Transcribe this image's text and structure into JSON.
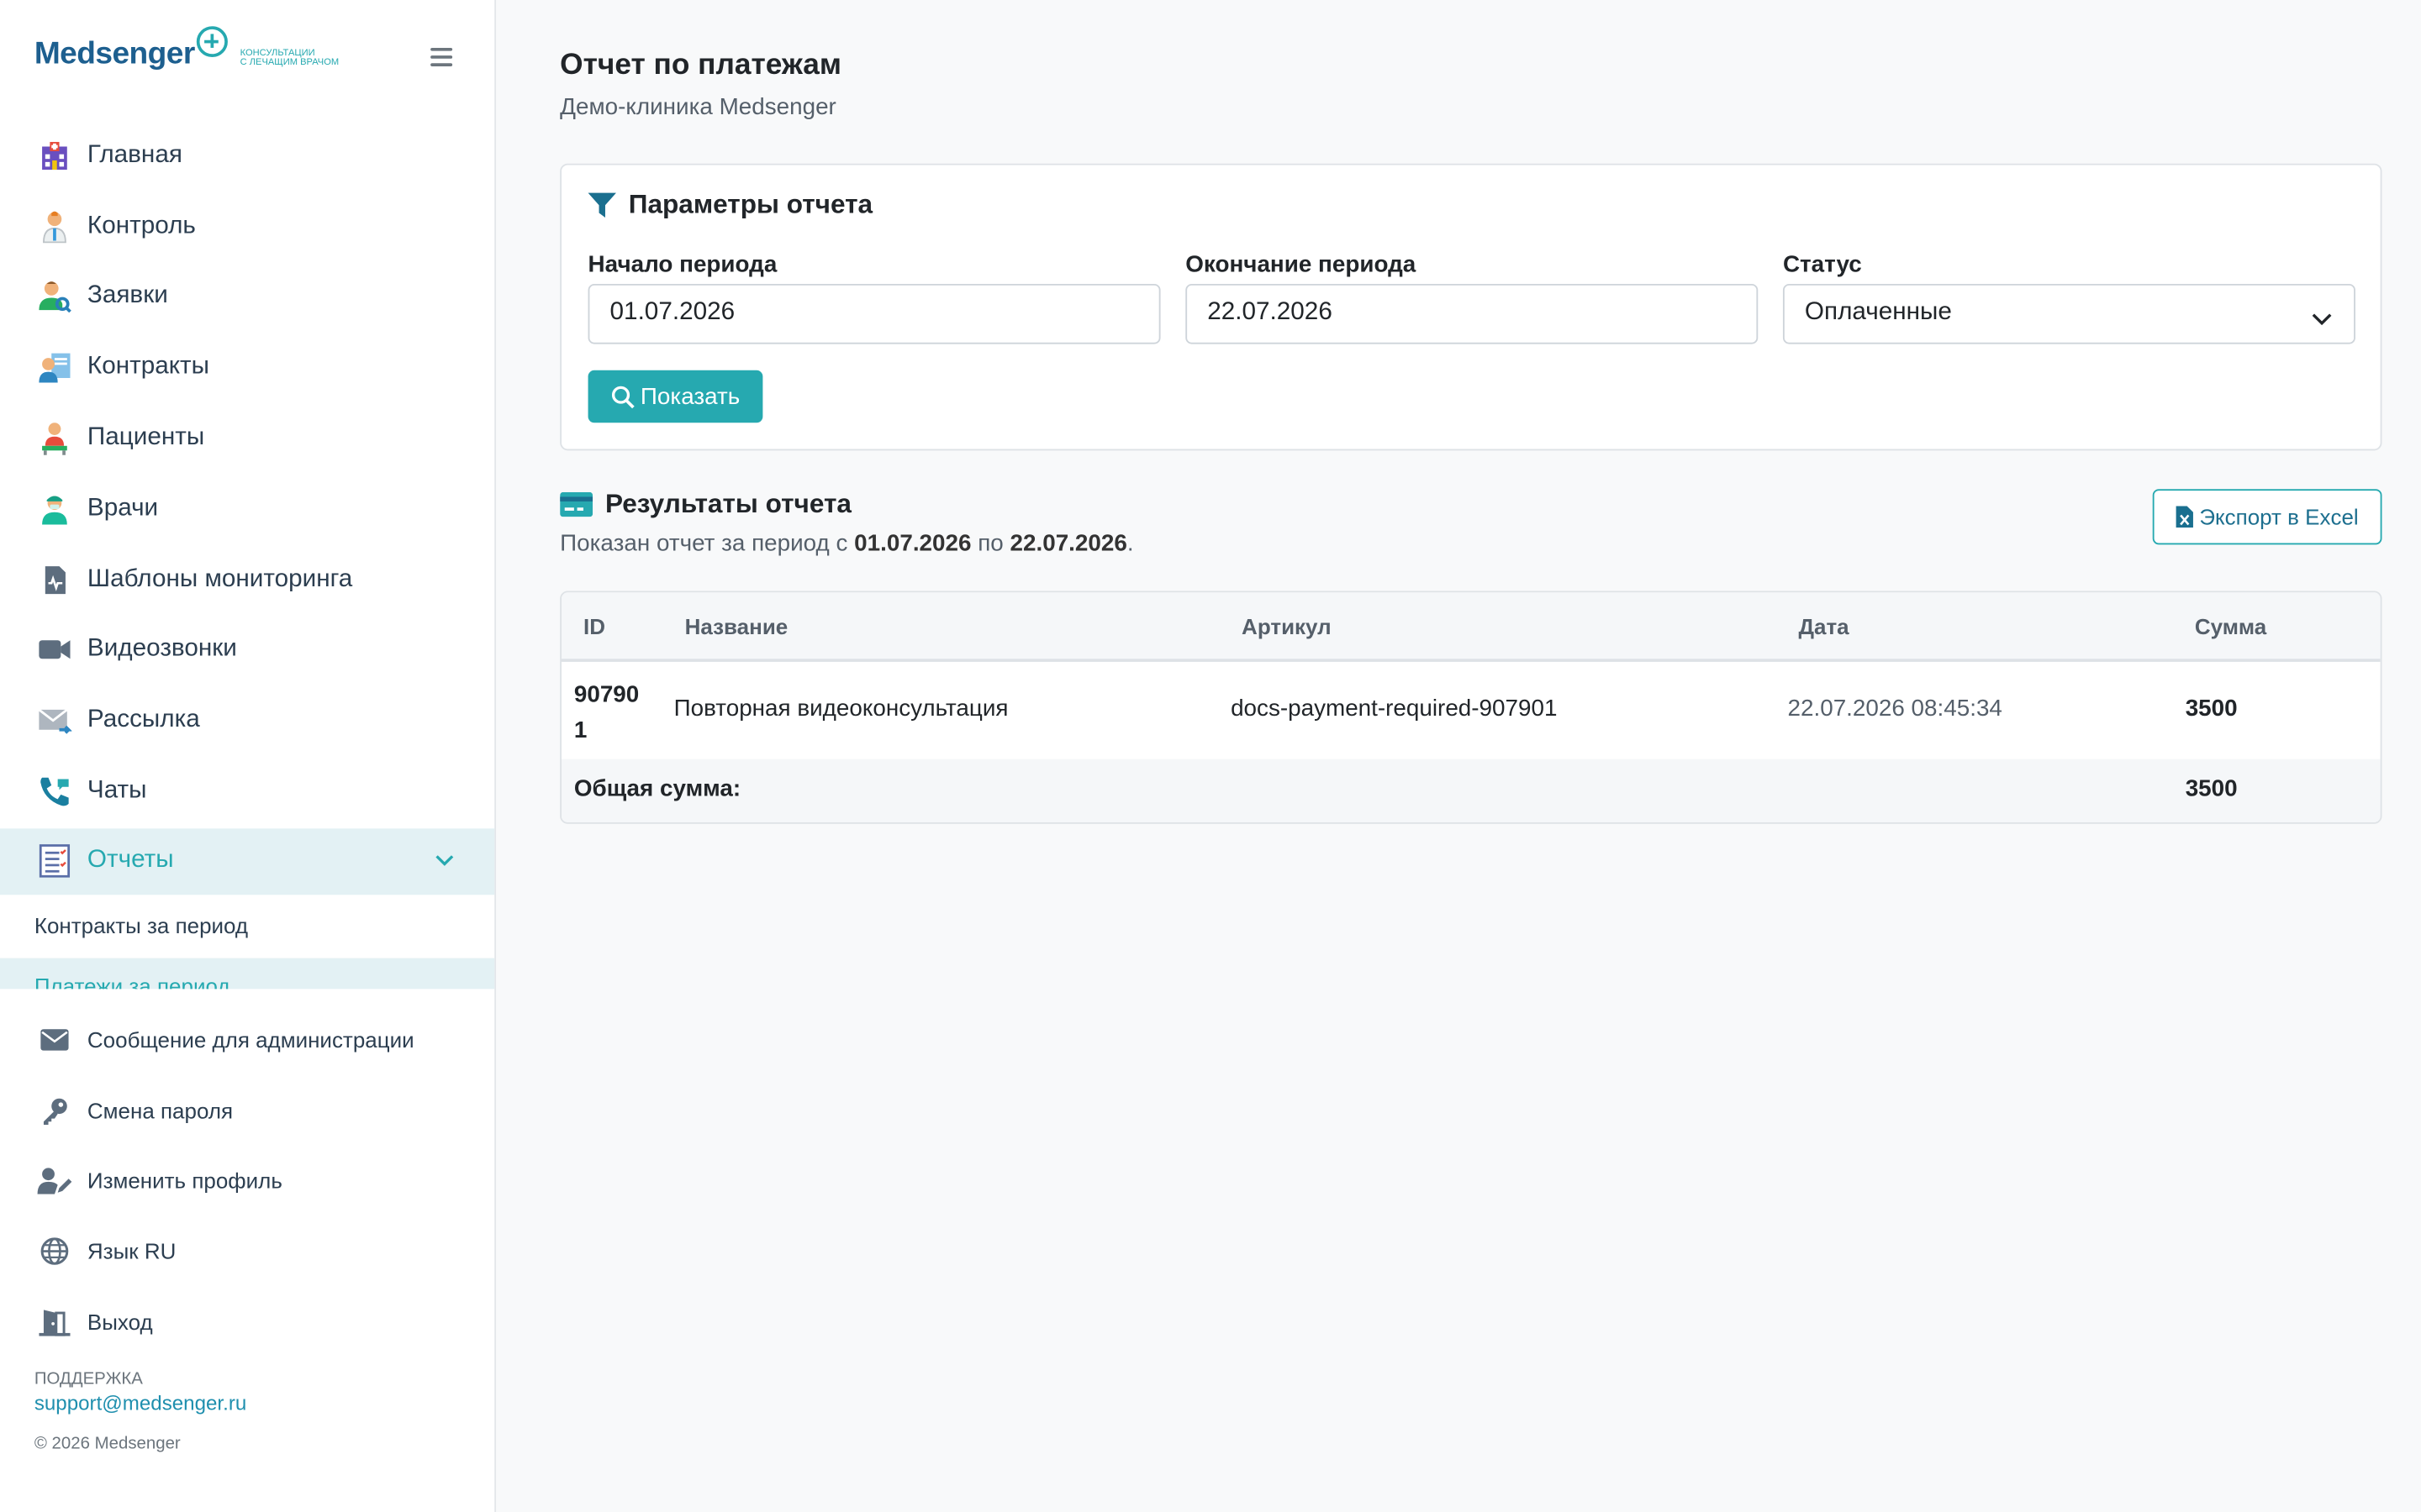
{
  "brand": {
    "name_part1": "Med",
    "name_part2": "senger",
    "tagline_line1": "КОНСУЛЬТАЦИИ",
    "tagline_line2": "С ЛЕЧАЩИМ ВРАЧОМ"
  },
  "sidebar": {
    "items": [
      {
        "label": "Главная",
        "icon": "hospital-icon"
      },
      {
        "label": "Контроль",
        "icon": "doctor-icon"
      },
      {
        "label": "Заявки",
        "icon": "user-search-icon"
      },
      {
        "label": "Контракты",
        "icon": "contract-icon"
      },
      {
        "label": "Пациенты",
        "icon": "patient-icon"
      },
      {
        "label": "Врачи",
        "icon": "medic-icon"
      },
      {
        "label": "Шаблоны мониторинга",
        "icon": "monitoring-template-icon"
      },
      {
        "label": "Видеозвонки",
        "icon": "video-camera-icon"
      },
      {
        "label": "Рассылка",
        "icon": "mail-send-icon"
      },
      {
        "label": "Чаты",
        "icon": "phone-chat-icon"
      }
    ],
    "active": {
      "label": "Отчеты",
      "icon": "report-list-icon"
    },
    "submenu": [
      "Контракты за период",
      "Платежи за период"
    ],
    "bottom": [
      {
        "label": "Сообщение для администрации",
        "icon": "envelope-icon"
      },
      {
        "label": "Смена пароля",
        "icon": "key-icon"
      },
      {
        "label": "Изменить профиль",
        "icon": "user-edit-icon"
      },
      {
        "label": "Язык RU",
        "icon": "globe-icon"
      },
      {
        "label": "Выход",
        "icon": "door-exit-icon"
      }
    ],
    "support_label": "ПОДДЕРЖКА",
    "support_email": "support@medsenger.ru",
    "copyright": "© 2026 Medsenger"
  },
  "page": {
    "title": "Отчет по платежам",
    "subtitle": "Демо-клиника Medsenger"
  },
  "params": {
    "title": "Параметры отчета",
    "start_label": "Начало периода",
    "start_value": "01.07.2026",
    "end_label": "Окончание периода",
    "end_value": "22.07.2026",
    "status_label": "Статус",
    "status_value": "Оплаченные",
    "show_button": "Показать"
  },
  "results": {
    "title": "Результаты отчета",
    "summary_prefix": "Показан отчет за период с ",
    "summary_from": "01.07.2026",
    "summary_mid": " по ",
    "summary_to": "22.07.2026",
    "summary_suffix": ".",
    "export_button": "Экспорт в Excel",
    "columns": [
      "ID",
      "Название",
      "Артикул",
      "Дата",
      "Сумма"
    ],
    "rows": [
      {
        "id_line1": "90790",
        "id_line2": "1",
        "name": "Повторная видеоконсультация",
        "sku": "docs-payment-required-907901",
        "date": "22.07.2026 08:45:34",
        "sum": "3500"
      }
    ],
    "total_label": "Общая сумма:",
    "total_value": "3500"
  },
  "colors": {
    "accent": "#26a9b0",
    "active_bg": "#e3f1f4",
    "brand_dark": "#1d5f8f"
  }
}
